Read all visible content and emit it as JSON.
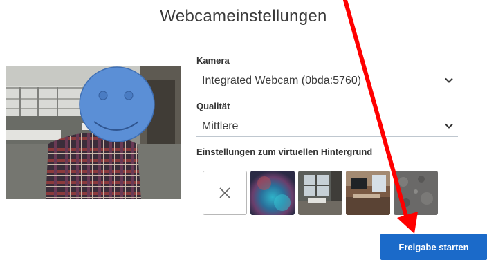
{
  "dialog": {
    "title": "Webcameinstellungen"
  },
  "camera": {
    "label": "Kamera",
    "selected": "Integrated Webcam (0bda:5760)"
  },
  "quality": {
    "label": "Qualität",
    "selected": "Mittlere"
  },
  "virtual_background": {
    "label": "Einstellungen zum virtuellen Hintergrund",
    "options": [
      {
        "name": "none",
        "icon": "close-icon"
      },
      {
        "name": "abstract-blur"
      },
      {
        "name": "office"
      },
      {
        "name": "modern-office"
      },
      {
        "name": "stone-texture"
      }
    ]
  },
  "actions": {
    "start_label": "Freigabe starten"
  },
  "colors": {
    "primary": "#1b6ac9",
    "annotation_arrow": "#ff0000",
    "face_overlay": "#5b8fd6"
  }
}
